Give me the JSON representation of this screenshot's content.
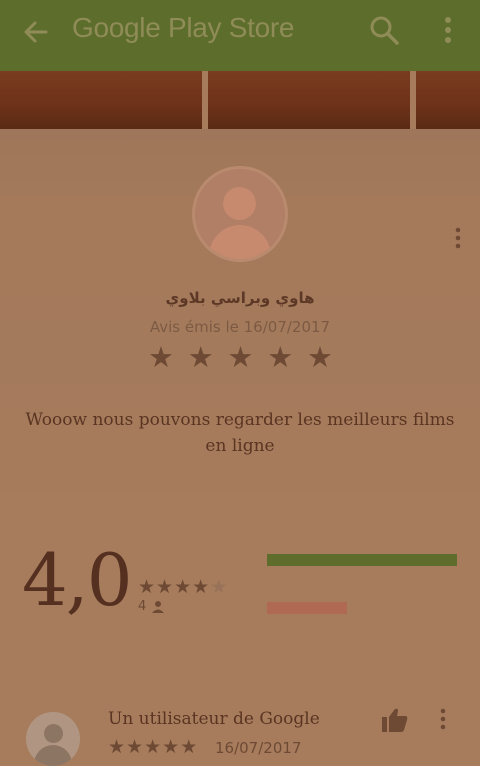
{
  "app_bar": {
    "title": "Google Play Store",
    "icons": [
      "arrow-back-icon",
      "search-icon",
      "more-vert-icon"
    ],
    "background": "#5d6d2b"
  },
  "review": {
    "reviewer_name": "هاوي وبراسي بلاوي",
    "date_label": "Avis émis le 16/07/2017",
    "stars": [
      "★",
      "★",
      "★",
      "★",
      "★"
    ],
    "text": "Wooow nous pouvons regarder les meilleurs films en ligne"
  },
  "rating_summary": {
    "average": "4,0",
    "stars": [
      "★",
      "★",
      "★",
      "★",
      "★"
    ],
    "filled_stars": 4,
    "count": "4",
    "bars": [
      {
        "fraction": 1.0,
        "color": "#5f6d2c"
      },
      {
        "fraction": 0.42,
        "color": "#b06a53"
      }
    ]
  },
  "comment": {
    "author": "Un utilisateur de Google",
    "stars": [
      "★",
      "★",
      "★",
      "★",
      "★"
    ],
    "date": "16/07/2017"
  },
  "colors": {
    "page_background": "#a67c5c",
    "accent_green": "#5d6d2b",
    "text_dark": "#5c3a25"
  }
}
